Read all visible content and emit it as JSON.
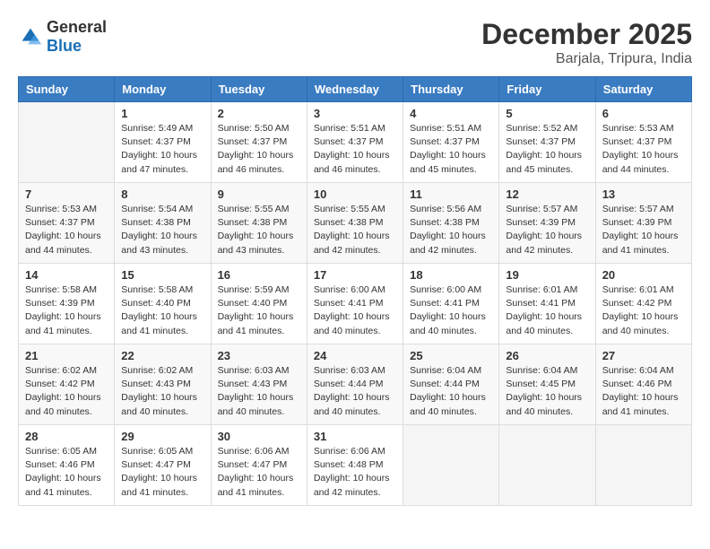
{
  "header": {
    "logo_general": "General",
    "logo_blue": "Blue",
    "month": "December 2025",
    "location": "Barjala, Tripura, India"
  },
  "weekdays": [
    "Sunday",
    "Monday",
    "Tuesday",
    "Wednesday",
    "Thursday",
    "Friday",
    "Saturday"
  ],
  "weeks": [
    [
      {
        "day": "",
        "sunrise": "",
        "sunset": "",
        "daylight": ""
      },
      {
        "day": "1",
        "sunrise": "Sunrise: 5:49 AM",
        "sunset": "Sunset: 4:37 PM",
        "daylight": "Daylight: 10 hours and 47 minutes."
      },
      {
        "day": "2",
        "sunrise": "Sunrise: 5:50 AM",
        "sunset": "Sunset: 4:37 PM",
        "daylight": "Daylight: 10 hours and 46 minutes."
      },
      {
        "day": "3",
        "sunrise": "Sunrise: 5:51 AM",
        "sunset": "Sunset: 4:37 PM",
        "daylight": "Daylight: 10 hours and 46 minutes."
      },
      {
        "day": "4",
        "sunrise": "Sunrise: 5:51 AM",
        "sunset": "Sunset: 4:37 PM",
        "daylight": "Daylight: 10 hours and 45 minutes."
      },
      {
        "day": "5",
        "sunrise": "Sunrise: 5:52 AM",
        "sunset": "Sunset: 4:37 PM",
        "daylight": "Daylight: 10 hours and 45 minutes."
      },
      {
        "day": "6",
        "sunrise": "Sunrise: 5:53 AM",
        "sunset": "Sunset: 4:37 PM",
        "daylight": "Daylight: 10 hours and 44 minutes."
      }
    ],
    [
      {
        "day": "7",
        "sunrise": "Sunrise: 5:53 AM",
        "sunset": "Sunset: 4:37 PM",
        "daylight": "Daylight: 10 hours and 44 minutes."
      },
      {
        "day": "8",
        "sunrise": "Sunrise: 5:54 AM",
        "sunset": "Sunset: 4:38 PM",
        "daylight": "Daylight: 10 hours and 43 minutes."
      },
      {
        "day": "9",
        "sunrise": "Sunrise: 5:55 AM",
        "sunset": "Sunset: 4:38 PM",
        "daylight": "Daylight: 10 hours and 43 minutes."
      },
      {
        "day": "10",
        "sunrise": "Sunrise: 5:55 AM",
        "sunset": "Sunset: 4:38 PM",
        "daylight": "Daylight: 10 hours and 42 minutes."
      },
      {
        "day": "11",
        "sunrise": "Sunrise: 5:56 AM",
        "sunset": "Sunset: 4:38 PM",
        "daylight": "Daylight: 10 hours and 42 minutes."
      },
      {
        "day": "12",
        "sunrise": "Sunrise: 5:57 AM",
        "sunset": "Sunset: 4:39 PM",
        "daylight": "Daylight: 10 hours and 42 minutes."
      },
      {
        "day": "13",
        "sunrise": "Sunrise: 5:57 AM",
        "sunset": "Sunset: 4:39 PM",
        "daylight": "Daylight: 10 hours and 41 minutes."
      }
    ],
    [
      {
        "day": "14",
        "sunrise": "Sunrise: 5:58 AM",
        "sunset": "Sunset: 4:39 PM",
        "daylight": "Daylight: 10 hours and 41 minutes."
      },
      {
        "day": "15",
        "sunrise": "Sunrise: 5:58 AM",
        "sunset": "Sunset: 4:40 PM",
        "daylight": "Daylight: 10 hours and 41 minutes."
      },
      {
        "day": "16",
        "sunrise": "Sunrise: 5:59 AM",
        "sunset": "Sunset: 4:40 PM",
        "daylight": "Daylight: 10 hours and 41 minutes."
      },
      {
        "day": "17",
        "sunrise": "Sunrise: 6:00 AM",
        "sunset": "Sunset: 4:41 PM",
        "daylight": "Daylight: 10 hours and 40 minutes."
      },
      {
        "day": "18",
        "sunrise": "Sunrise: 6:00 AM",
        "sunset": "Sunset: 4:41 PM",
        "daylight": "Daylight: 10 hours and 40 minutes."
      },
      {
        "day": "19",
        "sunrise": "Sunrise: 6:01 AM",
        "sunset": "Sunset: 4:41 PM",
        "daylight": "Daylight: 10 hours and 40 minutes."
      },
      {
        "day": "20",
        "sunrise": "Sunrise: 6:01 AM",
        "sunset": "Sunset: 4:42 PM",
        "daylight": "Daylight: 10 hours and 40 minutes."
      }
    ],
    [
      {
        "day": "21",
        "sunrise": "Sunrise: 6:02 AM",
        "sunset": "Sunset: 4:42 PM",
        "daylight": "Daylight: 10 hours and 40 minutes."
      },
      {
        "day": "22",
        "sunrise": "Sunrise: 6:02 AM",
        "sunset": "Sunset: 4:43 PM",
        "daylight": "Daylight: 10 hours and 40 minutes."
      },
      {
        "day": "23",
        "sunrise": "Sunrise: 6:03 AM",
        "sunset": "Sunset: 4:43 PM",
        "daylight": "Daylight: 10 hours and 40 minutes."
      },
      {
        "day": "24",
        "sunrise": "Sunrise: 6:03 AM",
        "sunset": "Sunset: 4:44 PM",
        "daylight": "Daylight: 10 hours and 40 minutes."
      },
      {
        "day": "25",
        "sunrise": "Sunrise: 6:04 AM",
        "sunset": "Sunset: 4:44 PM",
        "daylight": "Daylight: 10 hours and 40 minutes."
      },
      {
        "day": "26",
        "sunrise": "Sunrise: 6:04 AM",
        "sunset": "Sunset: 4:45 PM",
        "daylight": "Daylight: 10 hours and 40 minutes."
      },
      {
        "day": "27",
        "sunrise": "Sunrise: 6:04 AM",
        "sunset": "Sunset: 4:46 PM",
        "daylight": "Daylight: 10 hours and 41 minutes."
      }
    ],
    [
      {
        "day": "28",
        "sunrise": "Sunrise: 6:05 AM",
        "sunset": "Sunset: 4:46 PM",
        "daylight": "Daylight: 10 hours and 41 minutes."
      },
      {
        "day": "29",
        "sunrise": "Sunrise: 6:05 AM",
        "sunset": "Sunset: 4:47 PM",
        "daylight": "Daylight: 10 hours and 41 minutes."
      },
      {
        "day": "30",
        "sunrise": "Sunrise: 6:06 AM",
        "sunset": "Sunset: 4:47 PM",
        "daylight": "Daylight: 10 hours and 41 minutes."
      },
      {
        "day": "31",
        "sunrise": "Sunrise: 6:06 AM",
        "sunset": "Sunset: 4:48 PM",
        "daylight": "Daylight: 10 hours and 42 minutes."
      },
      {
        "day": "",
        "sunrise": "",
        "sunset": "",
        "daylight": ""
      },
      {
        "day": "",
        "sunrise": "",
        "sunset": "",
        "daylight": ""
      },
      {
        "day": "",
        "sunrise": "",
        "sunset": "",
        "daylight": ""
      }
    ]
  ]
}
